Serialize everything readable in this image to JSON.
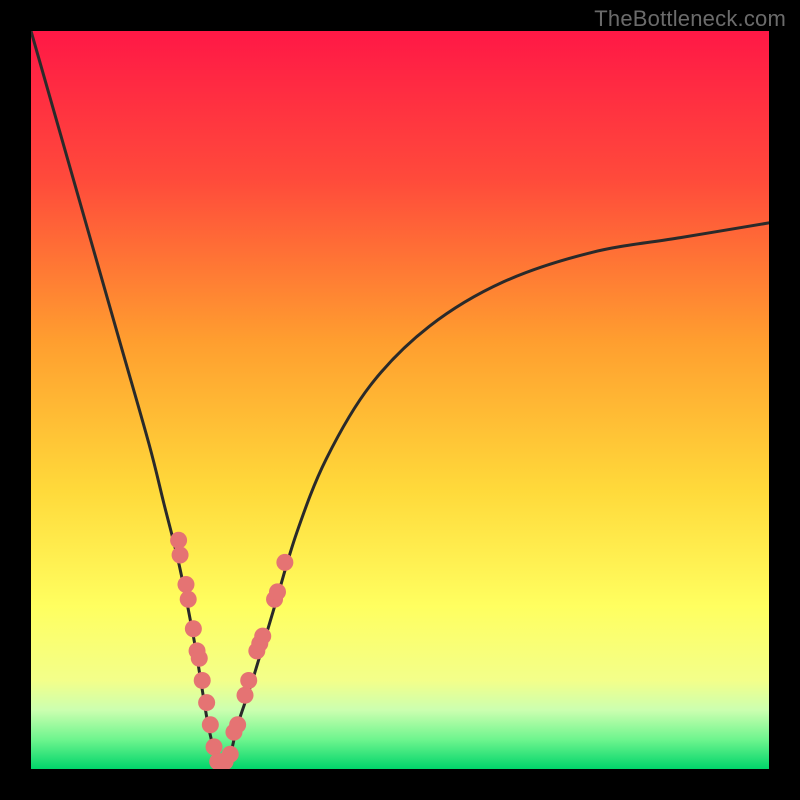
{
  "watermark": "TheBottleneck.com",
  "colors": {
    "frame": "#000000",
    "curve": "#2a2a2a",
    "dots": "#e57373",
    "gradient_stops": [
      {
        "pct": 0,
        "color": "#ff1846"
      },
      {
        "pct": 20,
        "color": "#ff4a3b"
      },
      {
        "pct": 42,
        "color": "#ff9e2f"
      },
      {
        "pct": 62,
        "color": "#ffd93a"
      },
      {
        "pct": 78,
        "color": "#ffff60"
      },
      {
        "pct": 88,
        "color": "#f3ff8a"
      },
      {
        "pct": 92,
        "color": "#ccffb0"
      },
      {
        "pct": 96,
        "color": "#6ef58e"
      },
      {
        "pct": 100,
        "color": "#00d46a"
      }
    ]
  },
  "chart_data": {
    "type": "line",
    "title": "",
    "xlabel": "",
    "ylabel": "",
    "xlim": [
      0,
      100
    ],
    "ylim": [
      0,
      100
    ],
    "grid": false,
    "legend": false,
    "series": [
      {
        "name": "bottleneck-curve",
        "x": [
          0,
          4,
          8,
          12,
          16,
          18,
          20,
          22,
          23,
          24,
          25,
          26,
          27,
          28,
          30,
          33,
          36,
          40,
          46,
          54,
          64,
          76,
          88,
          100
        ],
        "y": [
          100,
          86,
          72,
          58,
          44,
          36,
          28,
          18,
          12,
          6,
          2,
          1,
          2,
          6,
          12,
          22,
          32,
          42,
          52,
          60,
          66,
          70,
          72,
          74
        ]
      }
    ],
    "annotations": {
      "scatter_dots": [
        {
          "x": 20.0,
          "y": 31
        },
        {
          "x": 20.2,
          "y": 29
        },
        {
          "x": 21.0,
          "y": 25
        },
        {
          "x": 21.3,
          "y": 23
        },
        {
          "x": 22.0,
          "y": 19
        },
        {
          "x": 22.5,
          "y": 16
        },
        {
          "x": 22.8,
          "y": 15
        },
        {
          "x": 23.2,
          "y": 12
        },
        {
          "x": 23.8,
          "y": 9
        },
        {
          "x": 24.3,
          "y": 6
        },
        {
          "x": 24.8,
          "y": 3
        },
        {
          "x": 25.3,
          "y": 1
        },
        {
          "x": 25.8,
          "y": 1
        },
        {
          "x": 26.3,
          "y": 1
        },
        {
          "x": 27.0,
          "y": 2
        },
        {
          "x": 27.5,
          "y": 5
        },
        {
          "x": 28.0,
          "y": 6
        },
        {
          "x": 29.0,
          "y": 10
        },
        {
          "x": 29.5,
          "y": 12
        },
        {
          "x": 30.6,
          "y": 16
        },
        {
          "x": 31.0,
          "y": 17
        },
        {
          "x": 31.4,
          "y": 18
        },
        {
          "x": 33.0,
          "y": 23
        },
        {
          "x": 33.4,
          "y": 24
        },
        {
          "x": 34.4,
          "y": 28
        }
      ]
    }
  }
}
